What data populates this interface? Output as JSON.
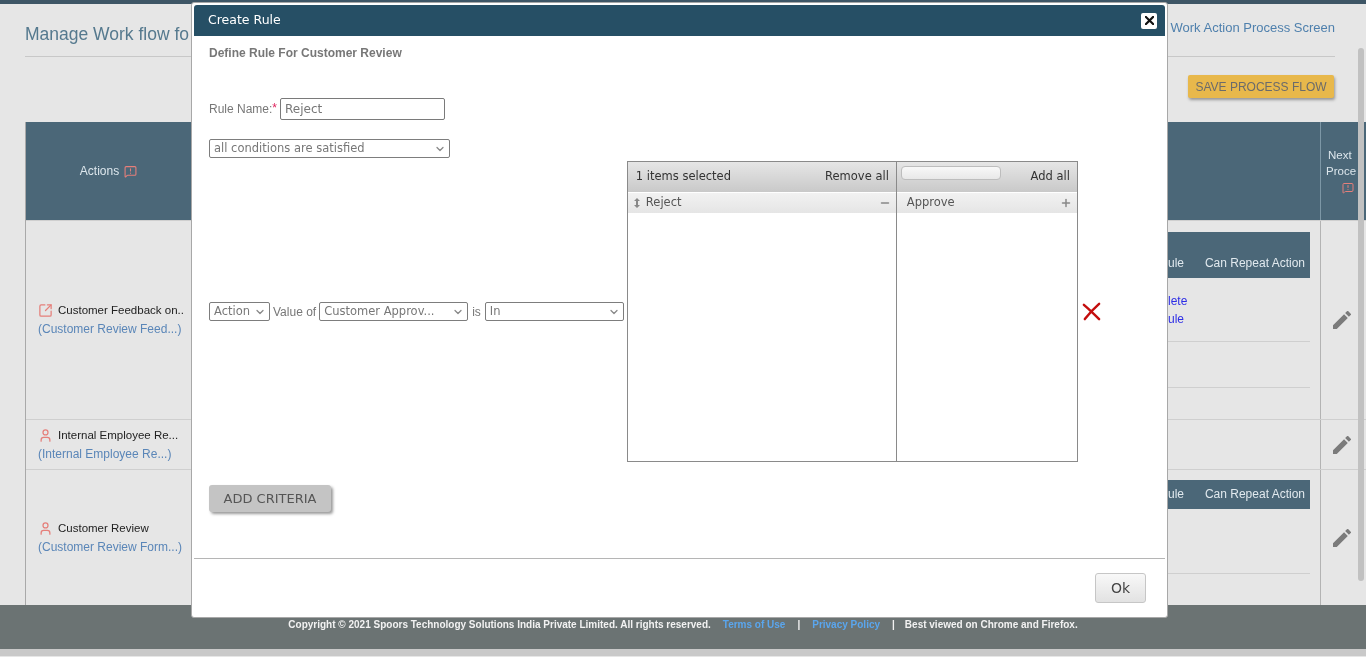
{
  "page": {
    "title": "Manage Work flow fo",
    "screen_link": "Work Action Process Screen",
    "save_button": "SAVE PROCESS FLOW"
  },
  "table": {
    "actions_header": "Actions",
    "next_header_lines": [
      "Next",
      "Proce"
    ],
    "rows": [
      {
        "kind": "external",
        "name": "Customer Feedback on..",
        "form": "(Customer Review Feed...)",
        "rules": {
          "columns": [
            "ule",
            "Can Repeat Action"
          ],
          "links": [
            "lete",
            "ule"
          ]
        }
      },
      {
        "kind": "user",
        "name": "Internal Employee Re...",
        "form": "(Internal Employee Re...)"
      },
      {
        "kind": "user",
        "name": "Customer Review",
        "form": "(Customer Review Form...)",
        "rules": {
          "columns": [
            "ule",
            "Can Repeat Action"
          ]
        }
      }
    ]
  },
  "footer": [
    {
      "kind": "text",
      "text": "Copyright © 2021 Spoors Technology Solutions India Private Limited. All rights reserved."
    },
    {
      "kind": "link",
      "text": "Terms of Use"
    },
    {
      "kind": "separator",
      "text": "|"
    },
    {
      "kind": "link",
      "text": "Privacy Policy"
    },
    {
      "kind": "separator",
      "text": "|"
    },
    {
      "kind": "text",
      "text": "Best viewed on Chrome and Firefox."
    }
  ],
  "dialog": {
    "title": "Create Rule",
    "subtitle": "Define Rule For Customer Review",
    "rule_name": {
      "label": "Rule Name:",
      "required_mark": "*",
      "value": "Reject"
    },
    "match_select": "all conditions are satisfied",
    "criteria": [
      {
        "field": "Action",
        "value_of": "Value of",
        "attribute": "Customer Approv...",
        "is": "is",
        "operator": "In",
        "selected": {
          "count_label": "1 items selected",
          "remove_all": "Remove all",
          "items": [
            "Reject"
          ]
        },
        "available": {
          "add_all": "Add all",
          "items": [
            "Approve"
          ]
        }
      }
    ],
    "add_criteria_button": "ADD CRITERIA",
    "ok_button": "Ok"
  }
}
